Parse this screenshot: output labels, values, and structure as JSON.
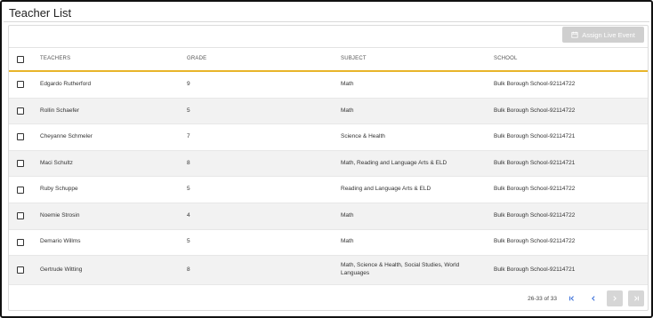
{
  "page": {
    "title": "Teacher List"
  },
  "toolbar": {
    "assign_label": "Assign Live Event",
    "assign_icon": "calendar-icon"
  },
  "table": {
    "headers": {
      "teachers": "TEACHERS",
      "grade": "GRADE",
      "subject": "SUBJECT",
      "school": "SCHOOL"
    },
    "rows": [
      {
        "name": "Edgardo Rutherford",
        "grade": "9",
        "subject": "Math",
        "school": "Bulk Borough School-92114722"
      },
      {
        "name": "Rollin Schaefer",
        "grade": "5",
        "subject": "Math",
        "school": "Bulk Borough School-92114722"
      },
      {
        "name": "Cheyanne Schmeler",
        "grade": "7",
        "subject": "Science & Health",
        "school": "Bulk Borough School-92114721"
      },
      {
        "name": "Maci Schultz",
        "grade": "8",
        "subject": "Math, Reading and Language Arts & ELD",
        "school": "Bulk Borough School-92114721"
      },
      {
        "name": "Ruby Schuppe",
        "grade": "5",
        "subject": "Reading and Language Arts & ELD",
        "school": "Bulk Borough School-92114722"
      },
      {
        "name": "Noemie Strosin",
        "grade": "4",
        "subject": "Math",
        "school": "Bulk Borough School-92114722"
      },
      {
        "name": "Demario Willms",
        "grade": "5",
        "subject": "Math",
        "school": "Bulk Borough School-92114722"
      },
      {
        "name": "Gertrude Witting",
        "grade": "8",
        "subject": "Math, Science & Health, Social Studies, World Languages",
        "school": "Bulk Borough School-92114721"
      }
    ]
  },
  "pagination": {
    "range_text": "26-33 of 33",
    "first_icon": "first-page-icon",
    "prev_icon": "chevron-left-icon",
    "next_icon": "chevron-right-icon",
    "last_icon": "last-page-icon"
  },
  "colors": {
    "accent": "#e8b529",
    "icon_blue": "#3a6fd8",
    "disabled": "#d6d6d6",
    "row_alt": "#f2f2f2"
  }
}
